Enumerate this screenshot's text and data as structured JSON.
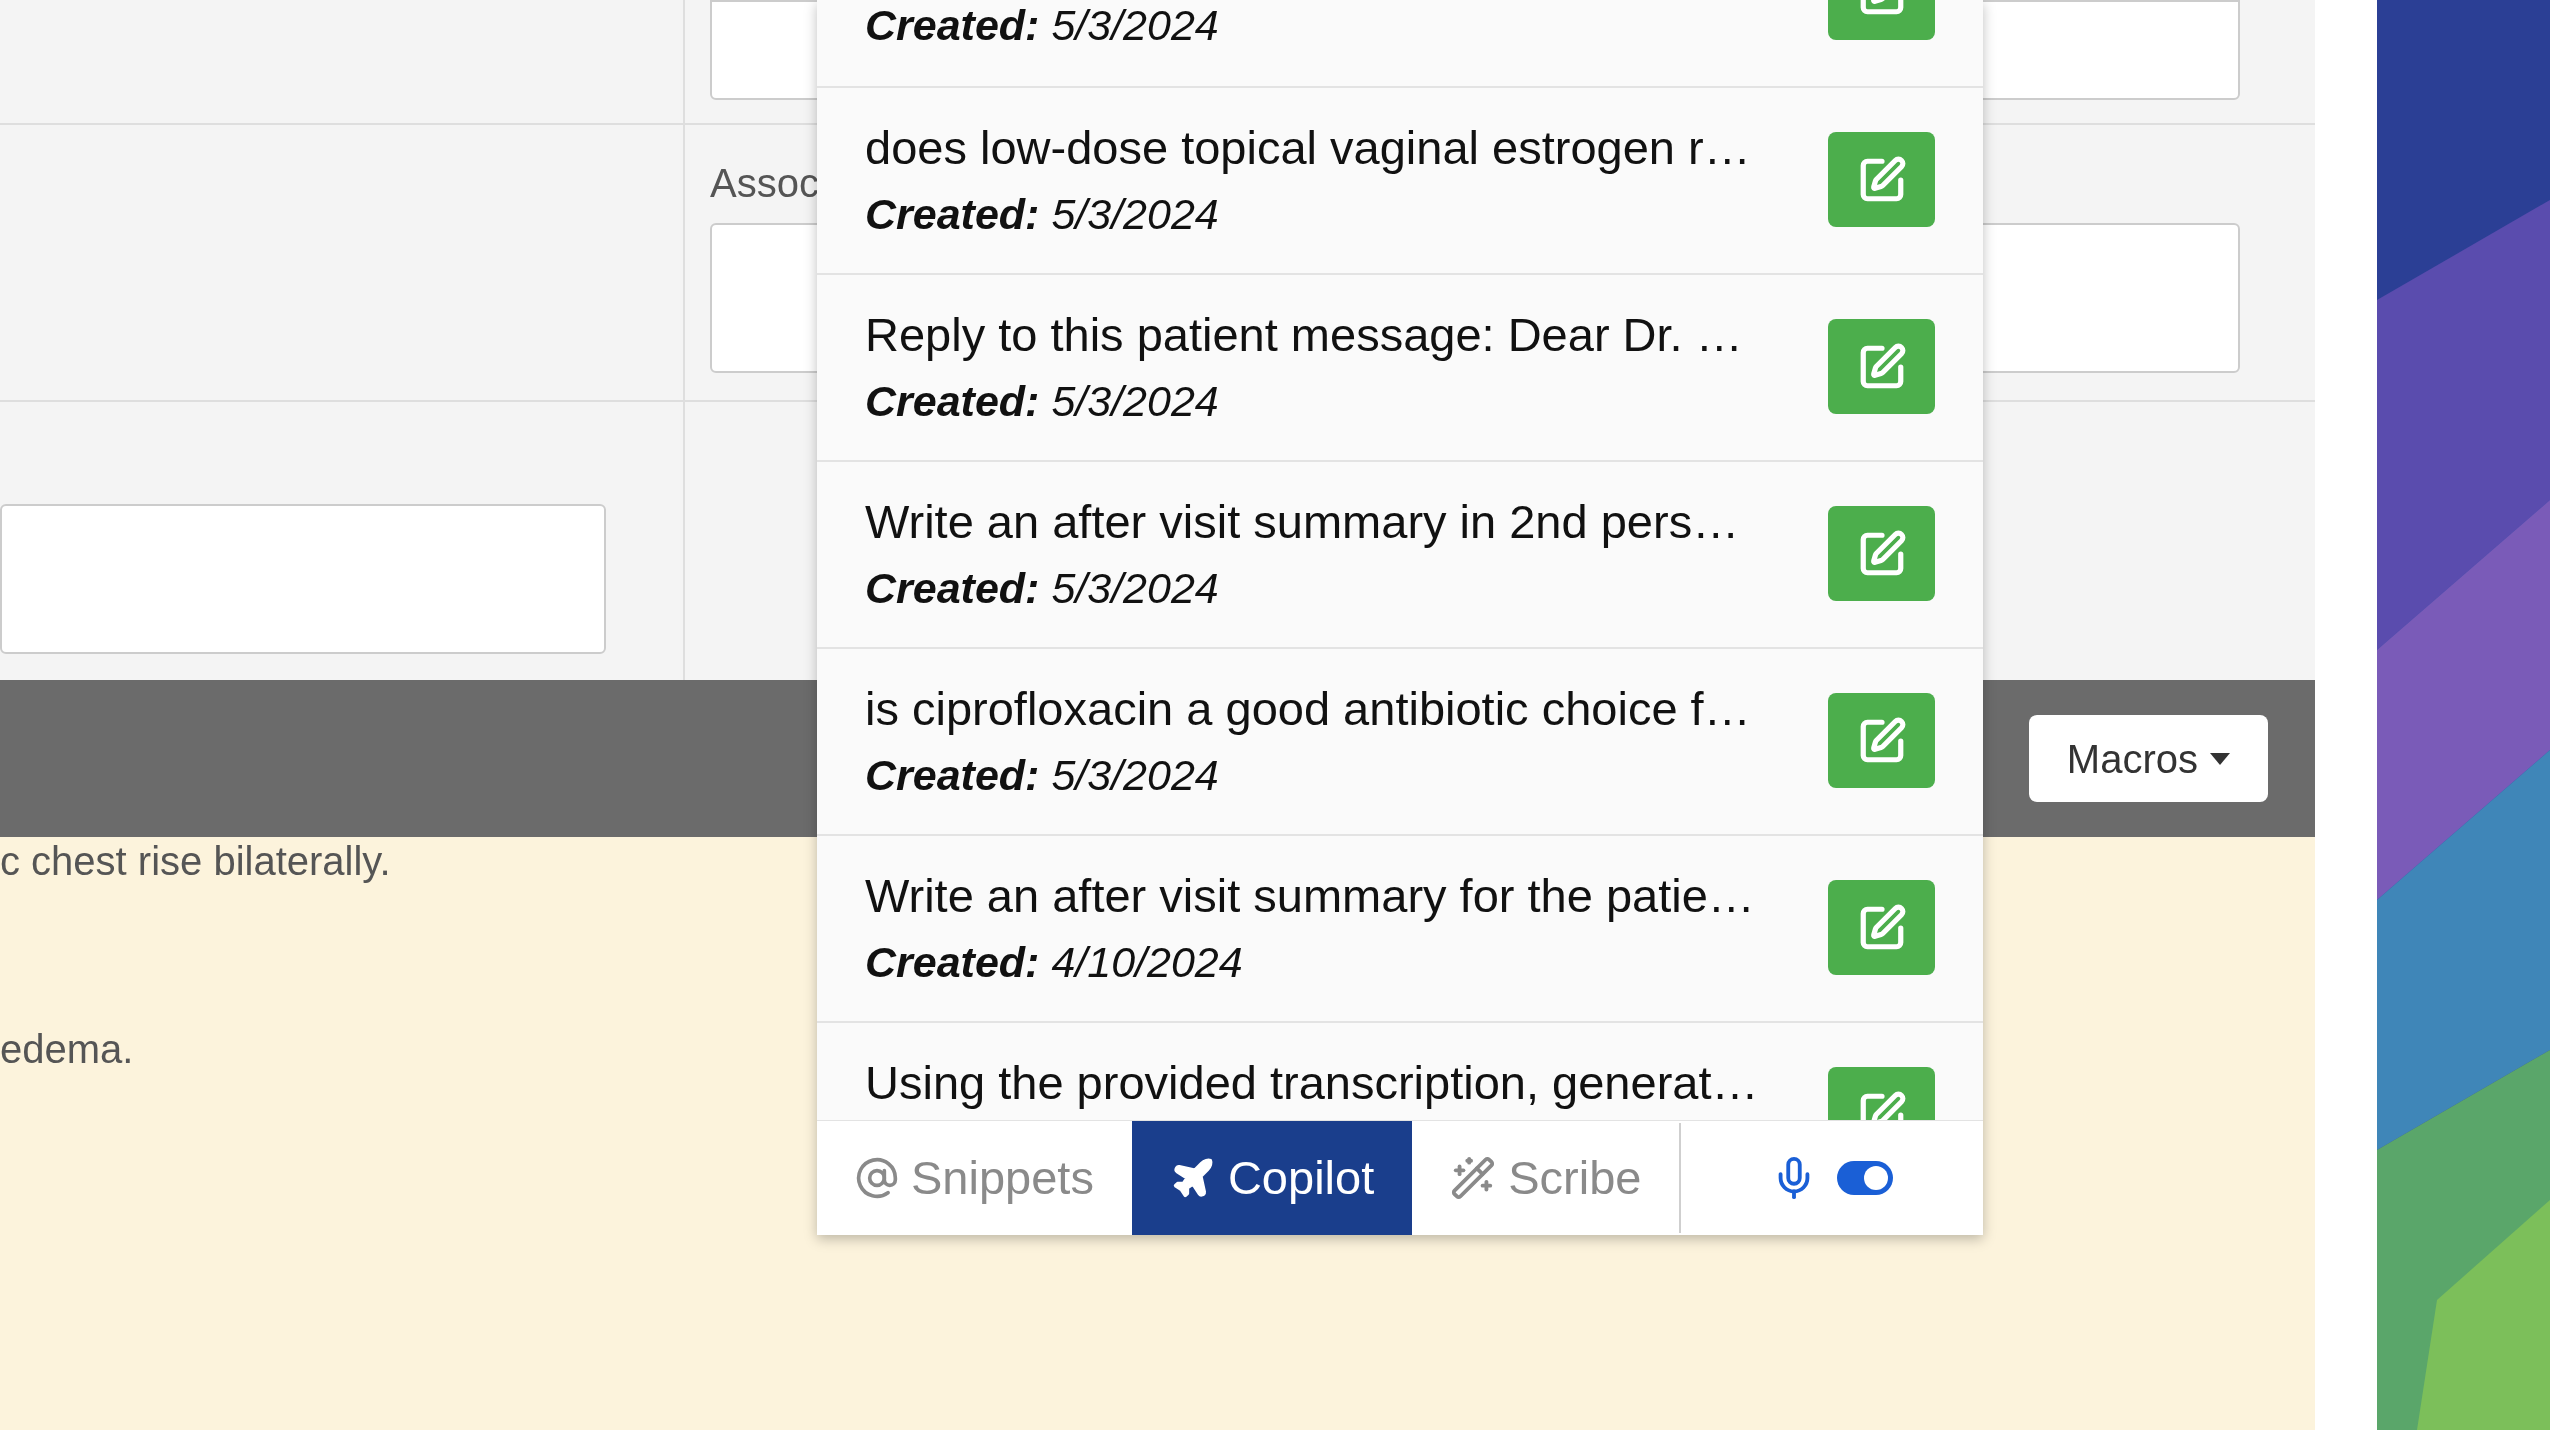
{
  "form": {
    "label": "Assoc",
    "note_lines": [
      "c chest rise bilaterally.",
      "edema."
    ]
  },
  "macros_button": {
    "label": "Macros"
  },
  "prompts": [
    {
      "created_label": "Created:",
      "date": "5/3/2024"
    },
    {
      "title": "does low-dose topical vaginal estrogen r…",
      "created_label": "Created:",
      "date": "5/3/2024"
    },
    {
      "title": "Reply to this patient message: Dear Dr. …",
      "created_label": "Created:",
      "date": "5/3/2024"
    },
    {
      "title": "Write an after visit summary in 2nd pers…",
      "created_label": "Created:",
      "date": "5/3/2024"
    },
    {
      "title": "is ciprofloxacin a good antibiotic choice f…",
      "created_label": "Created:",
      "date": "5/3/2024"
    },
    {
      "title": "Write an after visit summary for the patie…",
      "created_label": "Created:",
      "date": "4/10/2024"
    },
    {
      "title": "Using the provided transcription, generat…"
    }
  ],
  "tabs": [
    {
      "label": "Snippets",
      "kind": "snippets",
      "selected": false
    },
    {
      "label": "Copilot",
      "kind": "copilot",
      "selected": true
    },
    {
      "label": "Scribe",
      "kind": "scribe",
      "selected": false
    }
  ],
  "microphone": {
    "on": true
  }
}
